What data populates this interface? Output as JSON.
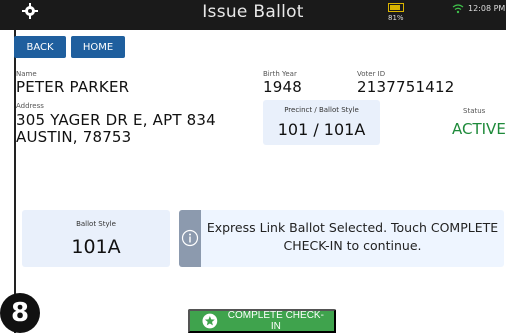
{
  "header": {
    "title": "Issue Ballot",
    "battery_pct": "81%",
    "time": "12:08 PM"
  },
  "nav": {
    "back_label": "BACK",
    "home_label": "HOME"
  },
  "voter": {
    "name_label": "Name",
    "name": "PETER PARKER",
    "birth_year_label": "Birth Year",
    "birth_year": "1948",
    "voter_id_label": "Voter ID",
    "voter_id": "2137751412",
    "address_label": "Address",
    "address_line1": "305 YAGER DR E, APT 834",
    "address_line2": "AUSTIN, 78753",
    "precinct_label": "Precinct / Ballot Style",
    "precinct": "101 / 101A",
    "status_label": "Status",
    "status": "ACTIVE"
  },
  "ballot": {
    "style_label": "Ballot Style",
    "style": "101A"
  },
  "message": {
    "text": "Express Link Ballot Selected. Touch COMPLETE CHECK-IN to continue."
  },
  "step": "8",
  "complete_label": "COMPLETE CHECK-IN",
  "colors": {
    "accent": "#1f5f9e",
    "status_active": "#1e8a3a",
    "complete": "#3fa34d",
    "panel": "#e9f0fb"
  },
  "icons": [
    "gear-icon",
    "battery-icon",
    "wifi-icon",
    "info-icon",
    "star-icon"
  ]
}
